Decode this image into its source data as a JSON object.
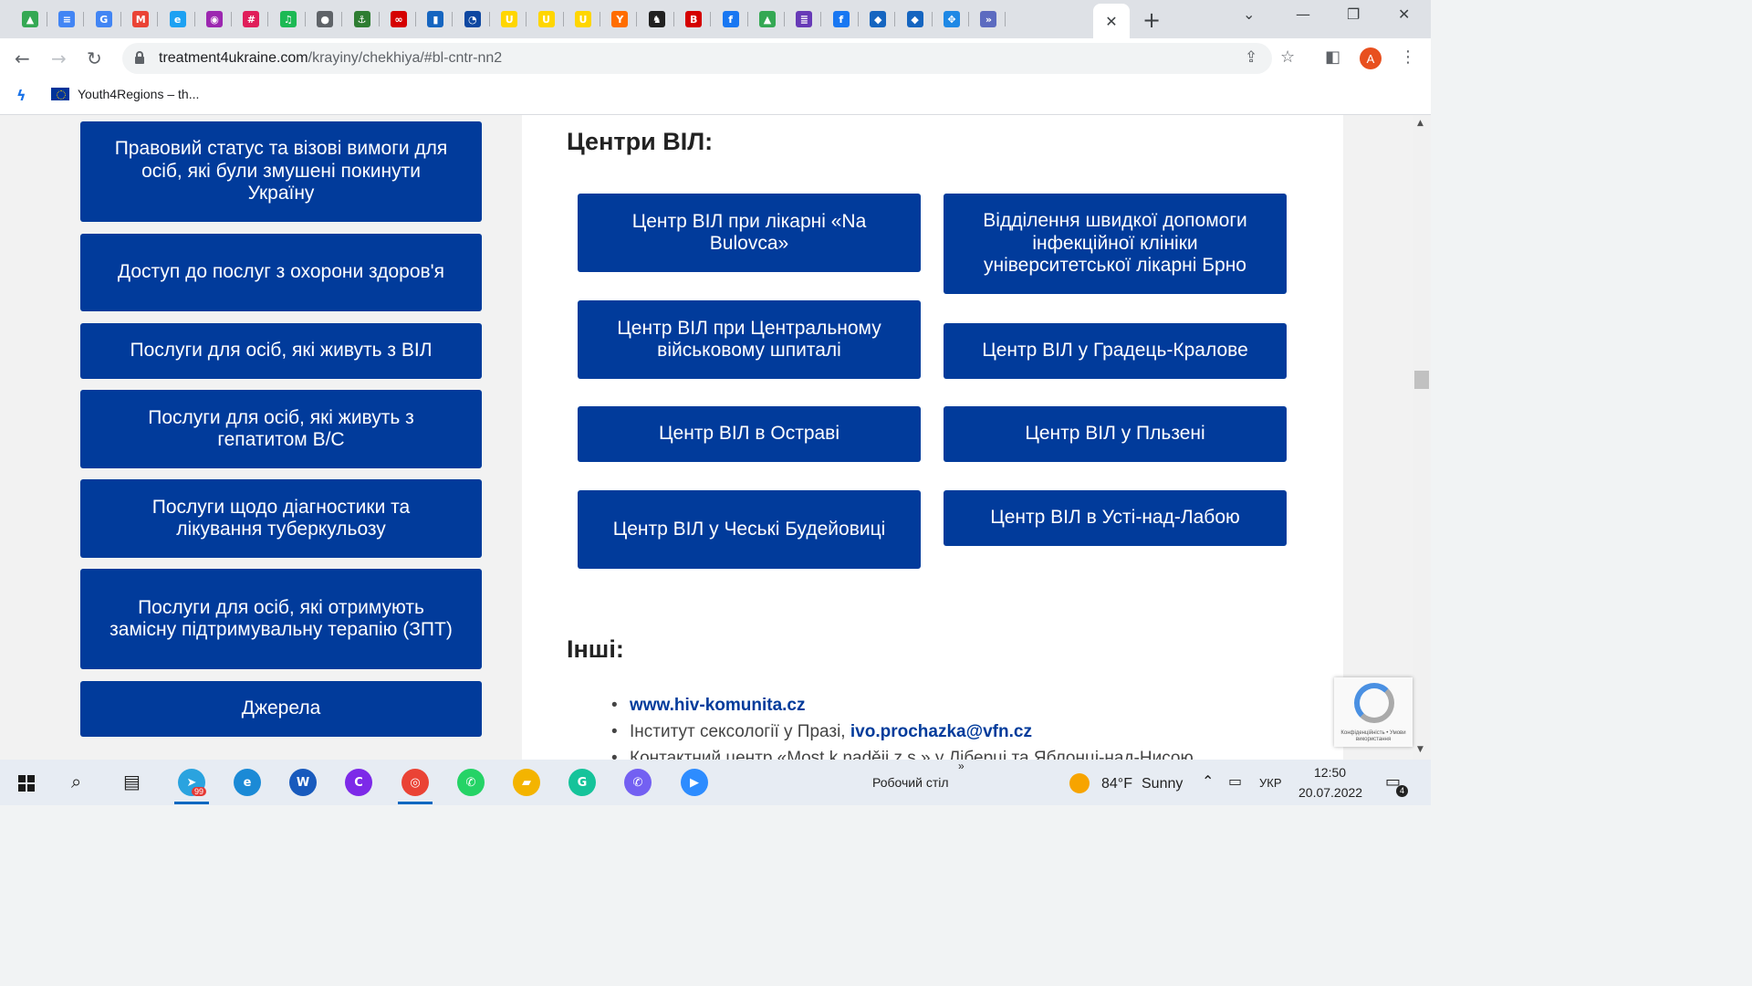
{
  "browser": {
    "tabs": [
      {
        "icon": "google-drive-icon",
        "color": "#34a853",
        "glyph": "▲"
      },
      {
        "icon": "google-docs-icon",
        "color": "#4285f4",
        "glyph": "≡"
      },
      {
        "icon": "google-translate-icon",
        "color": "#4285f4",
        "glyph": "G"
      },
      {
        "icon": "gmail-icon",
        "color": "#ea4335",
        "glyph": "M"
      },
      {
        "icon": "edge-icon",
        "color": "#1da1f2",
        "glyph": "e"
      },
      {
        "icon": "podcast-icon",
        "color": "#9c27b0",
        "glyph": "◉"
      },
      {
        "icon": "slack-icon",
        "color": "#e01e5a",
        "glyph": "#"
      },
      {
        "icon": "spotify-icon",
        "color": "#1db954",
        "glyph": "♫"
      },
      {
        "icon": "globe-icon",
        "color": "#5f6368",
        "glyph": "●"
      },
      {
        "icon": "anchor-icon",
        "color": "#2e7d32",
        "glyph": "⚓"
      },
      {
        "icon": "infinity-icon",
        "color": "#d50000",
        "glyph": "∞"
      },
      {
        "icon": "flag-icon",
        "color": "#1565c0",
        "glyph": "▮"
      },
      {
        "icon": "sync-icon",
        "color": "#0d47a1",
        "glyph": "◔"
      },
      {
        "icon": "u-icon-1",
        "color": "#ffd600",
        "glyph": "U"
      },
      {
        "icon": "u-icon-2",
        "color": "#ffd600",
        "glyph": "U"
      },
      {
        "icon": "u-icon-3",
        "color": "#ffd600",
        "glyph": "U"
      },
      {
        "icon": "bird-icon",
        "color": "#ff6d00",
        "glyph": "Y"
      },
      {
        "icon": "cat-icon",
        "color": "#212121",
        "glyph": "♞"
      },
      {
        "icon": "b-icon",
        "color": "#d50000",
        "glyph": "B"
      },
      {
        "icon": "facebook-icon-1",
        "color": "#1877f2",
        "glyph": "f"
      },
      {
        "icon": "google-drive-icon-2",
        "color": "#34a853",
        "glyph": "▲"
      },
      {
        "icon": "forms-icon",
        "color": "#673ab7",
        "glyph": "≣"
      },
      {
        "icon": "facebook-icon-2",
        "color": "#1877f2",
        "glyph": "f"
      },
      {
        "icon": "shield-ua-icon-1",
        "color": "#1565c0",
        "glyph": "◆"
      },
      {
        "icon": "shield-ua-icon-2",
        "color": "#1565c0",
        "glyph": "◆"
      },
      {
        "icon": "move-icon",
        "color": "#1e88e5",
        "glyph": "✥"
      },
      {
        "icon": "chevrons-icon",
        "color": "#5c6bc0",
        "glyph": "»"
      }
    ],
    "url_host": "treatment4ukraine.com",
    "url_path": "/krayiny/chekhiya/#bl-cntr-nn2",
    "avatar_letter": "A",
    "bookmark_label": "Youth4Regions – th..."
  },
  "sidebar": {
    "items": [
      {
        "label": "Правовий статус та візові вимоги для осіб, які були змушені покинути Україну"
      },
      {
        "label": "Доступ до послуг з охорони здоров'я"
      },
      {
        "label": "Послуги для осіб, які живуть з ВІЛ"
      },
      {
        "label": "Послуги для осіб, які живуть з гепатитом B/C"
      },
      {
        "label": "Послуги щодо діагностики та лікування туберкульозу"
      },
      {
        "label": "Послуги для осіб, які отримують замісну підтримувальну терапію (ЗПТ)"
      },
      {
        "label": "Джерела"
      }
    ]
  },
  "main": {
    "hiv_heading": "Центри ВІЛ:",
    "hiv_centers": [
      {
        "label": "Центр ВІЛ при лікарні «Na Bulovca»"
      },
      {
        "label": "Відділення швидкої допомоги інфекційної клініки університетської лікарні Брно"
      },
      {
        "label": "Центр ВІЛ при Центральному військовому шпиталі"
      },
      {
        "label": "Центр ВІЛ у Градець-Кралове"
      },
      {
        "label": "Центр ВІЛ в Остраві"
      },
      {
        "label": "Центр ВІЛ у Пльзені"
      },
      {
        "label": "Центр ВІЛ у Чеські Будейовиці"
      },
      {
        "label": "Центр ВІЛ в Усті-над-Лабою"
      }
    ],
    "other_heading": "Інші:",
    "other_links": [
      {
        "prefix": "",
        "link": "www.hiv-komunita.cz"
      },
      {
        "prefix": "Інститут сексології у Празі, ",
        "link": "ivo.prochazka@vfn.cz"
      },
      {
        "prefix": "Контактний центр «Most k naději z.s.» у Ліберці та Яблонці-над-Нисою",
        "link": ""
      }
    ]
  },
  "recaptcha": {
    "text": "Конфіденційність • Умови використання"
  },
  "taskbar": {
    "desktop_label": "Робочий стіл",
    "weather_temp": "84°F",
    "weather_desc": "Sunny",
    "language": "УКР",
    "time": "12:50",
    "date": "20.07.2022",
    "telegram_badge": "99",
    "notif_count": "4",
    "apps": [
      {
        "icon": "telegram-icon",
        "color": "#2aa3df",
        "glyph": "➤"
      },
      {
        "icon": "edge-icon",
        "color": "#1b8ad6",
        "glyph": "e"
      },
      {
        "icon": "word-icon",
        "color": "#185abd",
        "glyph": "W"
      },
      {
        "icon": "canva-icon",
        "color": "#7d2ae8",
        "glyph": "C"
      },
      {
        "icon": "chrome-icon",
        "color": "#ea4335",
        "glyph": "◎"
      },
      {
        "icon": "whatsapp-icon",
        "color": "#25d366",
        "glyph": "✆"
      },
      {
        "icon": "file-explorer-icon",
        "color": "#f4b400",
        "glyph": "▰"
      },
      {
        "icon": "grammarly-icon",
        "color": "#15c39a",
        "glyph": "G"
      },
      {
        "icon": "viber-icon",
        "color": "#7360f2",
        "glyph": "✆"
      },
      {
        "icon": "zoom-icon",
        "color": "#2d8cff",
        "glyph": "▶"
      }
    ]
  }
}
